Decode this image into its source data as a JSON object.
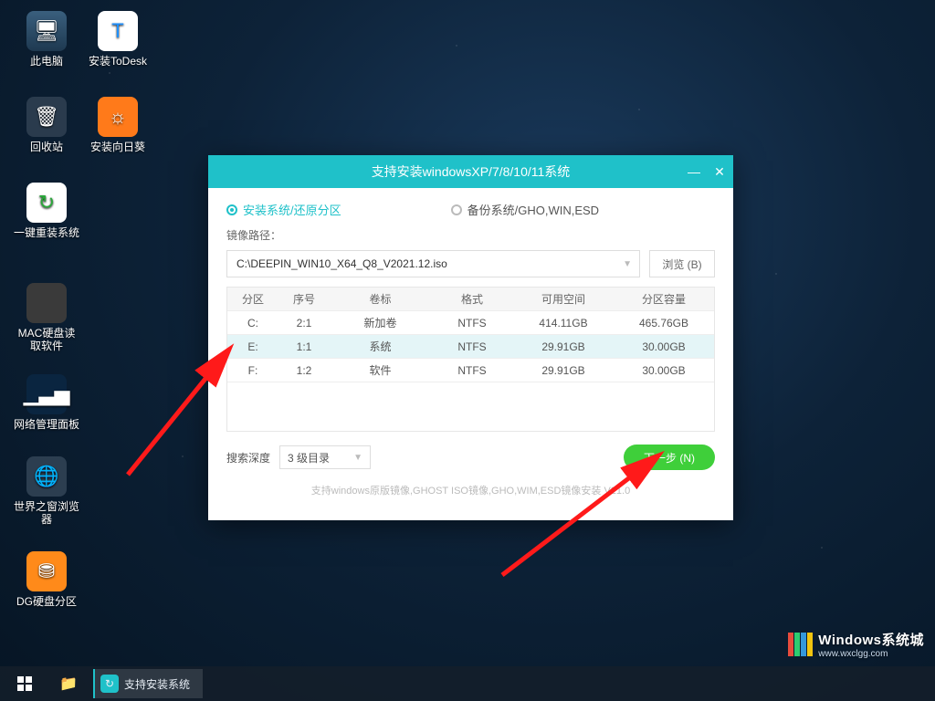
{
  "desktop": {
    "icons": [
      {
        "label": "此电脑"
      },
      {
        "label": "安装ToDesk"
      },
      {
        "label": "回收站"
      },
      {
        "label": "安装向日葵"
      },
      {
        "label": "一键重装系统"
      },
      {
        "label": "MAC硬盘读取软件"
      },
      {
        "label": "网络管理面板"
      },
      {
        "label": "世界之窗浏览器"
      },
      {
        "label": "DG硬盘分区"
      }
    ]
  },
  "window": {
    "title": "支持安装windowsXP/7/8/10/11系统",
    "tab_install": "安装系统/还原分区",
    "tab_backup": "备份系统/GHO,WIN,ESD",
    "path_label": "镜像路径：",
    "path_value": "C:\\DEEPIN_WIN10_X64_Q8_V2021.12.iso",
    "browse": "浏览 (B)",
    "columns": {
      "c1": "分区",
      "c2": "序号",
      "c3": "卷标",
      "c4": "格式",
      "c5": "可用空间",
      "c6": "分区容量"
    },
    "rows": [
      {
        "c1": "C:",
        "c2": "2:1",
        "c3": "新加卷",
        "c4": "NTFS",
        "c5": "414.11GB",
        "c6": "465.76GB"
      },
      {
        "c1": "E:",
        "c2": "1:1",
        "c3": "系统",
        "c4": "NTFS",
        "c5": "29.91GB",
        "c6": "30.00GB"
      },
      {
        "c1": "F:",
        "c2": "1:2",
        "c3": "软件",
        "c4": "NTFS",
        "c5": "29.91GB",
        "c6": "30.00GB"
      }
    ],
    "depth_label": "搜索深度",
    "depth_value": "3 级目录",
    "next": "下一步 (N)",
    "note": "支持windows原版镜像,GHOST ISO镜像,GHO,WIM,ESD镜像安装 V21.0"
  },
  "taskbar": {
    "task_label": "支持安装系统"
  },
  "watermark": {
    "title": "Windows系统城",
    "url": "www.wxclgg.com"
  }
}
